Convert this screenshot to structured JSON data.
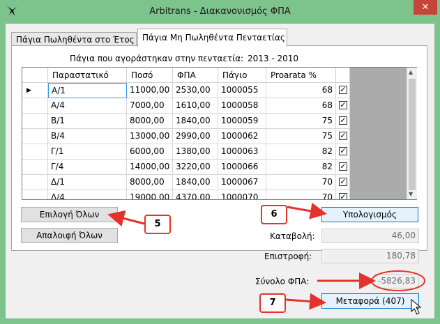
{
  "window": {
    "title": "Arbitrans - Διακανονισμός ΦΠΑ",
    "close_glyph": "✕",
    "icon": "bird-logo-icon"
  },
  "tabs": [
    {
      "label": "Πάγια Πωληθέντα στο Έτος",
      "active": false
    },
    {
      "label": "Πάγια Μη Πωληθέντα Πενταετίας",
      "active": true
    }
  ],
  "period": {
    "label": "Πάγια που αγοράστηκαν στην πενταετία:",
    "value": "2013 - 2010"
  },
  "grid": {
    "columns": [
      "Παραστατικό",
      "Ποσό",
      "ΦΠΑ",
      "Πάγιο",
      "Proarata %",
      ""
    ],
    "rows": [
      {
        "doc": "Α/1",
        "amount": "11000,00",
        "vat": "2530,00",
        "asset": "1000055",
        "pct": "68",
        "checked": true,
        "current": true
      },
      {
        "doc": "Α/4",
        "amount": "7000,00",
        "vat": "1610,00",
        "asset": "1000058",
        "pct": "68",
        "checked": true,
        "current": false
      },
      {
        "doc": "Β/1",
        "amount": "8000,00",
        "vat": "1840,00",
        "asset": "1000059",
        "pct": "75",
        "checked": true,
        "current": false
      },
      {
        "doc": "Β/4",
        "amount": "13000,00",
        "vat": "2990,00",
        "asset": "1000062",
        "pct": "75",
        "checked": true,
        "current": false
      },
      {
        "doc": "Γ/1",
        "amount": "6000,00",
        "vat": "1380,00",
        "asset": "1000063",
        "pct": "82",
        "checked": true,
        "current": false
      },
      {
        "doc": "Γ/4",
        "amount": "14000,00",
        "vat": "3220,00",
        "asset": "1000066",
        "pct": "82",
        "checked": true,
        "current": false
      },
      {
        "doc": "Δ/1",
        "amount": "8000,00",
        "vat": "1840,00",
        "asset": "1000067",
        "pct": "70",
        "checked": true,
        "current": false
      },
      {
        "doc": "Δ/4",
        "amount": "19000,00",
        "vat": "4370,00",
        "asset": "1000070",
        "pct": "70",
        "checked": true,
        "current": false
      }
    ]
  },
  "buttons": {
    "select_all": "Επιλογή Όλων",
    "deselect_all": "Απαλοιφή Όλων",
    "calculate": "Υπολογισμός",
    "transfer": "Μεταφορά (407)"
  },
  "fields": {
    "payment_label": "Καταβολή:",
    "payment_value": "46,00",
    "refund_label": "Επιστροφή:",
    "refund_value": "180,78",
    "total_label": "Σύνολο ΦΠΑ:",
    "total_value": "-5826,83"
  },
  "annotations": {
    "badge_5": "5",
    "badge_6": "6",
    "badge_7": "7",
    "color": "#e5322d"
  },
  "colors": {
    "title_bar": "#7cc38c",
    "close_button": "#c6443a",
    "focus_border": "#0078d7"
  }
}
